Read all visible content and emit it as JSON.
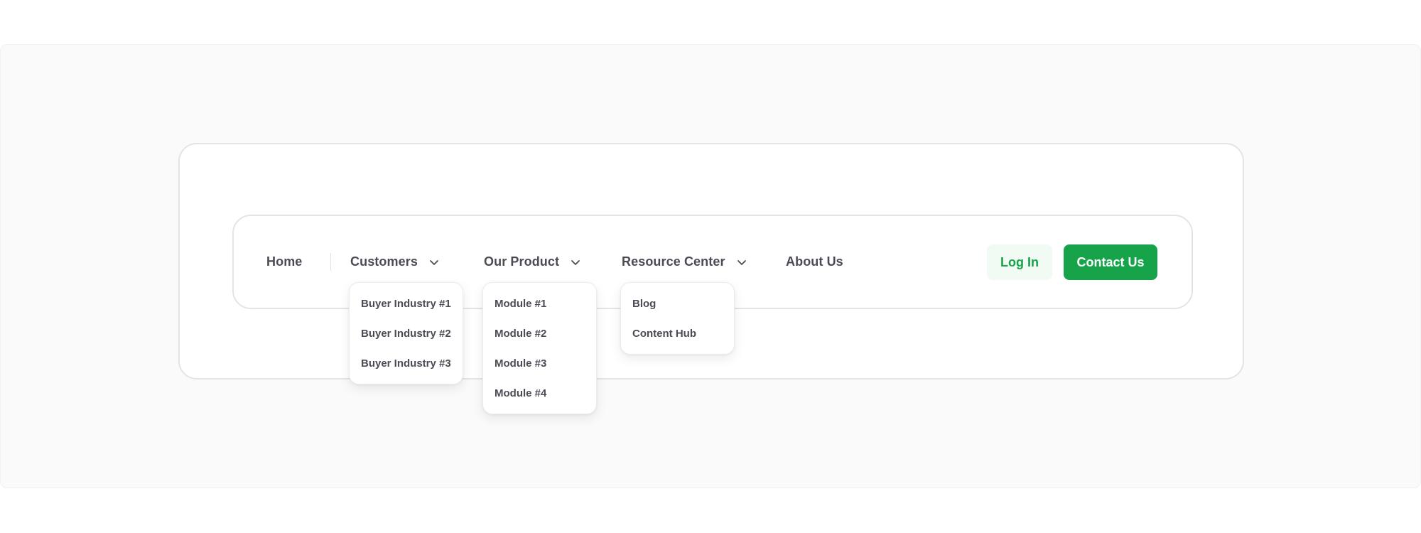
{
  "nav": {
    "items": [
      {
        "label": "Home"
      },
      {
        "label": "Customers"
      },
      {
        "label": "Our Product"
      },
      {
        "label": "Resource Center"
      },
      {
        "label": "About Us"
      }
    ],
    "login_label": "Log In",
    "contact_label": "Contact Us"
  },
  "dropdowns": {
    "customers": [
      "Buyer Industry #1",
      "Buyer Industry #2",
      "Buyer Industry #3"
    ],
    "product": [
      "Module #1",
      "Module #2",
      "Module #3",
      "Module #4"
    ],
    "resources": [
      "Blog",
      "Content Hub"
    ]
  },
  "colors": {
    "accent": "#16a34a",
    "accent_soft": "#f1fbf4",
    "text": "#4b4b55",
    "border": "#e4e4e6",
    "canvas": "#fafafa"
  },
  "icons": {
    "dropdown_indicator": "chevron-down-icon"
  }
}
